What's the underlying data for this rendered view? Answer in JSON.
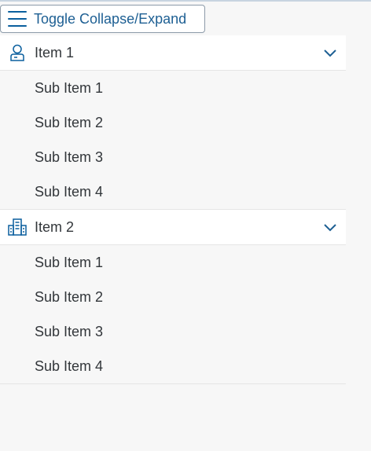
{
  "toolbar": {
    "toggle_label": "Toggle Collapse/Expand"
  },
  "nav": {
    "groups": [
      {
        "label": "Item 1",
        "icon": "person-icon",
        "expanded": true,
        "items": [
          "Sub Item 1",
          "Sub Item 2",
          "Sub Item 3",
          "Sub Item 4"
        ]
      },
      {
        "label": "Item 2",
        "icon": "building-icon",
        "expanded": true,
        "items": [
          "Sub Item 1",
          "Sub Item 2",
          "Sub Item 3",
          "Sub Item 4"
        ]
      }
    ]
  },
  "colors": {
    "accent": "#0a5f9e",
    "header_bg": "#ffffff",
    "list_bg": "#f7f7f7",
    "text": "#32363a"
  }
}
